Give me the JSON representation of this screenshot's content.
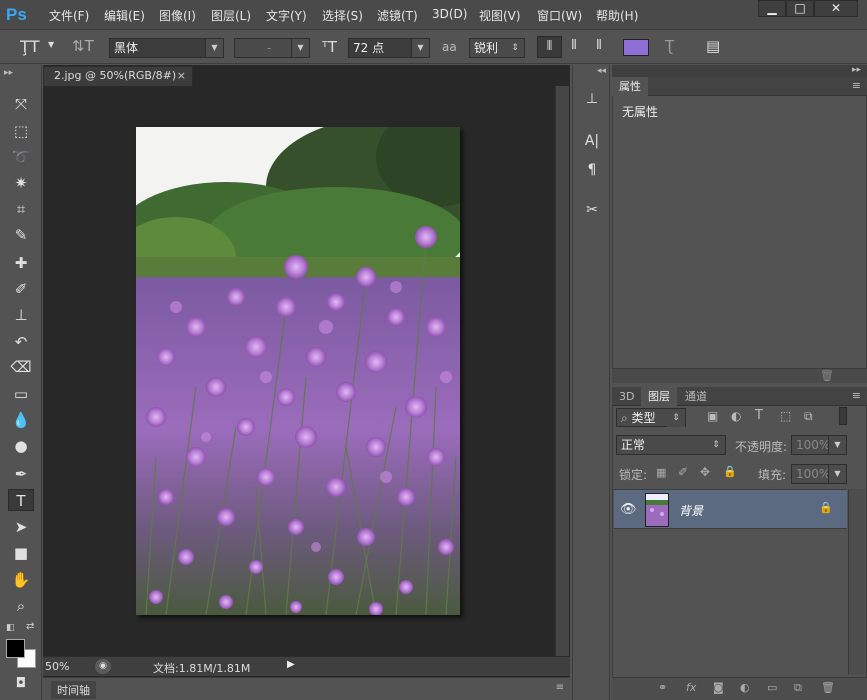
{
  "app": {
    "logo": "Ps"
  },
  "menu": [
    "文件(F)",
    "编辑(E)",
    "图像(I)",
    "图层(L)",
    "文字(Y)",
    "选择(S)",
    "滤镜(T)",
    "3D(D)",
    "视图(V)",
    "窗口(W)",
    "帮助(H)"
  ],
  "window_controls": {
    "minimize": "▁",
    "maximize": "□",
    "close": "✕"
  },
  "options": {
    "font_family": "黑体",
    "font_style": "-",
    "font_size": "72 点",
    "aa_label": "aa",
    "antialias": "锐利",
    "text_color": "#8f6fd6"
  },
  "document": {
    "tab_title": "2.jpg @ 50%(RGB/8#)",
    "tab_close": "×",
    "zoom": "50%",
    "doc_info": "文档:1.81M/1.81M"
  },
  "timeline": {
    "label": "时间轴"
  },
  "properties": {
    "tab": "属性",
    "content": "无属性"
  },
  "layers": {
    "tabs": [
      "3D",
      "图层",
      "通道"
    ],
    "filter_kind": "类型",
    "blend_mode": "正常",
    "opacity_label": "不透明度:",
    "opacity_value": "100%",
    "lock_label": "锁定:",
    "fill_label": "填充:",
    "fill_value": "100%",
    "layer_name": "背景"
  },
  "colors": {
    "foreground": "#000000",
    "background": "#ffffff",
    "selected_layer": "#5b6a81"
  }
}
